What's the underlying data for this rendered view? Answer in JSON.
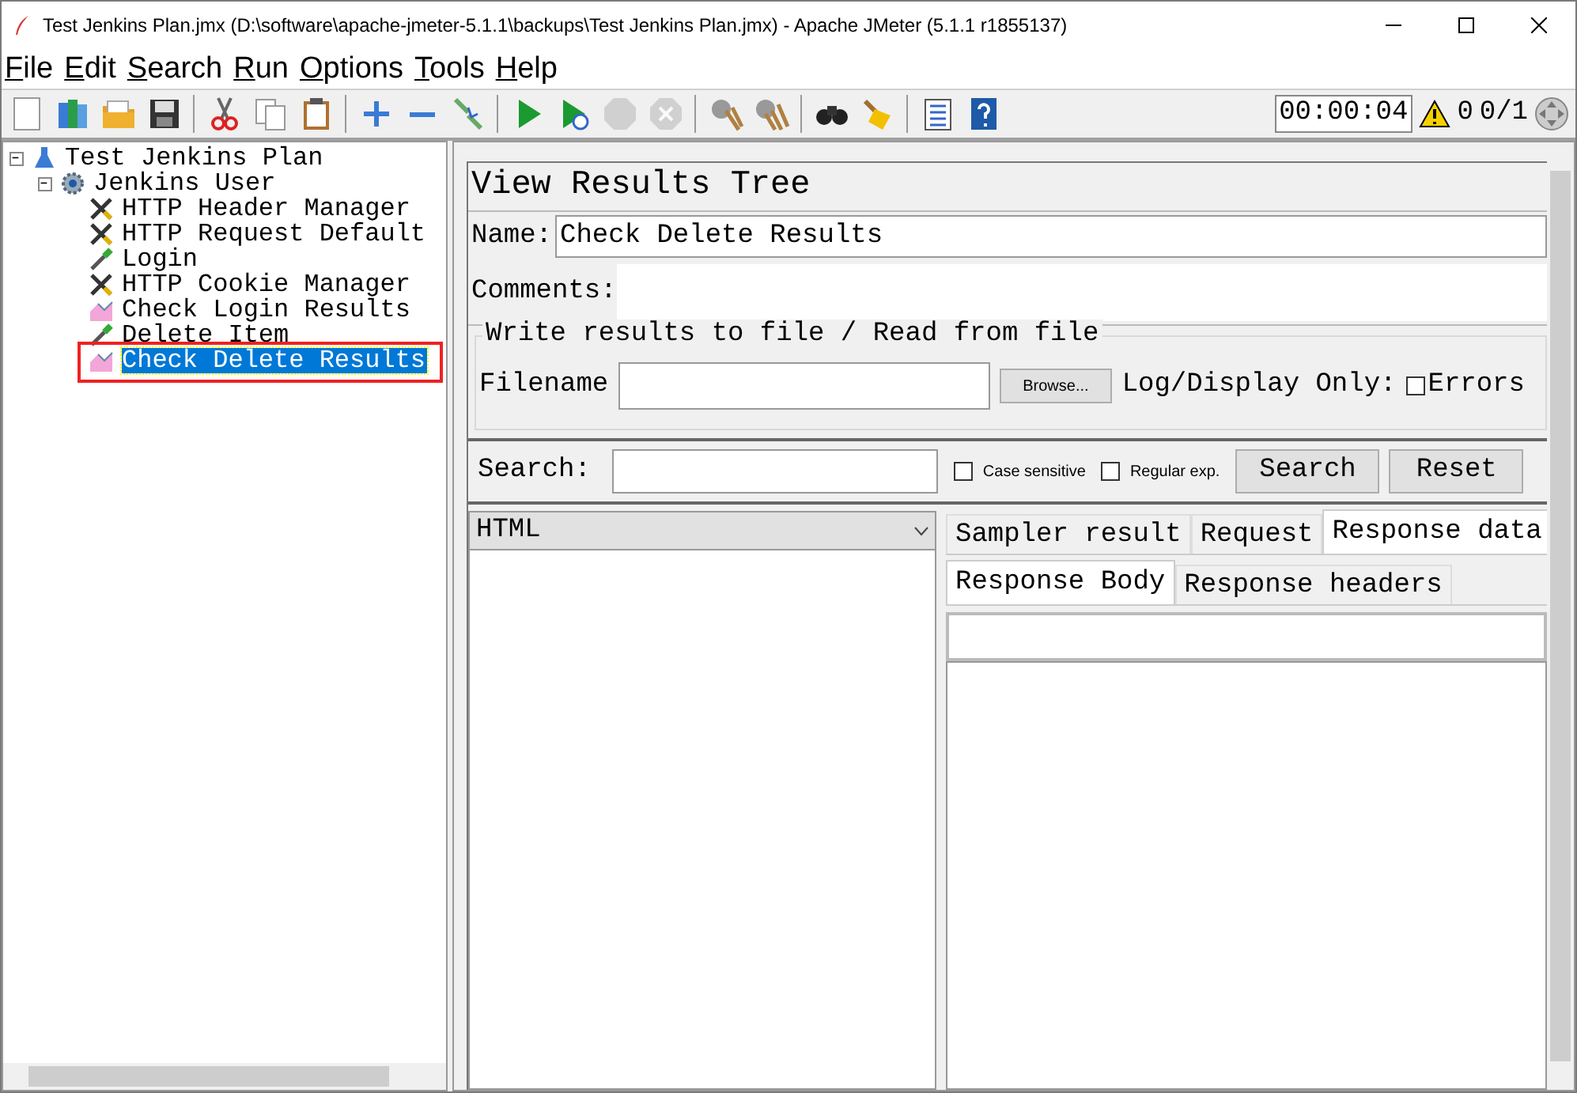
{
  "window": {
    "title": "Test Jenkins Plan.jmx (D:\\software\\apache-jmeter-5.1.1\\backups\\Test Jenkins Plan.jmx) - Apache JMeter (5.1.1 r1855137)"
  },
  "menu": [
    "File",
    "Edit",
    "Search",
    "Run",
    "Options",
    "Tools",
    "Help"
  ],
  "toolbar": [
    {
      "kind": "new",
      "disabled": false
    },
    {
      "kind": "templates",
      "disabled": false
    },
    {
      "kind": "open",
      "disabled": false
    },
    {
      "kind": "save",
      "disabled": false
    },
    {
      "kind": "separator"
    },
    {
      "kind": "cut",
      "disabled": false
    },
    {
      "kind": "copy",
      "disabled": false
    },
    {
      "kind": "paste",
      "disabled": false
    },
    {
      "kind": "separator"
    },
    {
      "kind": "expand",
      "disabled": false
    },
    {
      "kind": "collapse",
      "disabled": false
    },
    {
      "kind": "toggle",
      "disabled": false
    },
    {
      "kind": "separator"
    },
    {
      "kind": "start",
      "disabled": false
    },
    {
      "kind": "start_no_timers",
      "disabled": false
    },
    {
      "kind": "stop",
      "disabled": true
    },
    {
      "kind": "shutdown",
      "disabled": true
    },
    {
      "kind": "separator"
    },
    {
      "kind": "clear",
      "disabled": false
    },
    {
      "kind": "clear_all",
      "disabled": false
    },
    {
      "kind": "separator"
    },
    {
      "kind": "search",
      "disabled": false
    },
    {
      "kind": "reset_search",
      "disabled": false
    },
    {
      "kind": "separator"
    },
    {
      "kind": "function_helper",
      "disabled": false
    },
    {
      "kind": "help",
      "disabled": false
    }
  ],
  "status": {
    "elapsed": "00:00:04",
    "warnings": "0",
    "threads": "0/1"
  },
  "tree": [
    {
      "label": "Test Jenkins Plan",
      "kind": "plan",
      "expanded": true,
      "selected": false,
      "children": [
        {
          "label": "Jenkins User",
          "kind": "thread_group",
          "expanded": true,
          "selected": false,
          "children": [
            {
              "label": "HTTP Header Manager",
              "kind": "config",
              "selected": false,
              "highlighted": false
            },
            {
              "label": "HTTP Request Default",
              "kind": "config",
              "selected": false,
              "highlighted": false
            },
            {
              "label": "Login",
              "kind": "sampler",
              "selected": false,
              "highlighted": false
            },
            {
              "label": "HTTP Cookie Manager",
              "kind": "config",
              "selected": false,
              "highlighted": false
            },
            {
              "label": "Check Login Results",
              "kind": "listener",
              "selected": false,
              "highlighted": false
            },
            {
              "label": "Delete Item",
              "kind": "sampler",
              "selected": false,
              "highlighted": false
            },
            {
              "label": "Check Delete Results",
              "kind": "listener",
              "selected": true,
              "highlighted": true
            }
          ]
        }
      ]
    }
  ],
  "panel": {
    "title": "View Results Tree",
    "name_label": "Name:",
    "name_value": "Check Delete Results",
    "comments_label": "Comments:",
    "file_group": {
      "legend": "Write results to file / Read from file",
      "filename_label": "Filename",
      "browse_button": "Browse...",
      "log_label": "Log/Display Only:",
      "errors": {
        "label": "Errors",
        "checked": false
      }
    },
    "search": {
      "label": "Search:",
      "case_sensitive": {
        "label": "Case sensitive",
        "checked": false
      },
      "regular_exp": {
        "label": "Regular exp.",
        "checked": false
      },
      "search_button": "Search",
      "reset_button": "Reset"
    },
    "renderer": {
      "value": "HTML"
    },
    "tabs": [
      {
        "label": "Sampler result",
        "selected": false
      },
      {
        "label": "Request",
        "selected": false
      },
      {
        "label": "Response data",
        "selected": true
      }
    ],
    "subtabs": [
      {
        "label": "Response Body",
        "selected": true
      },
      {
        "label": "Response headers",
        "selected": false
      }
    ]
  }
}
